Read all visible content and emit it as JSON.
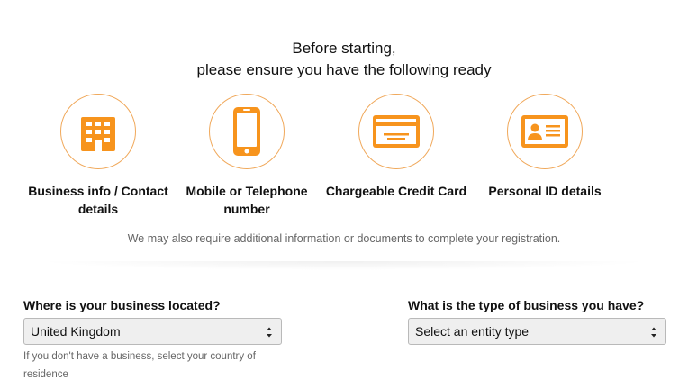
{
  "heading": {
    "line1": "Before starting,",
    "line2": "please ensure you have the following ready"
  },
  "requirements": [
    {
      "icon": "building-icon",
      "label": "Business info / Contact details"
    },
    {
      "icon": "mobile-phone-icon",
      "label": "Mobile or Telephone number"
    },
    {
      "icon": "credit-card-icon",
      "label": "Chargeable Credit Card"
    },
    {
      "icon": "id-card-icon",
      "label": "Personal ID details"
    }
  ],
  "note": "We may also require additional information or documents to complete your registration.",
  "location_field": {
    "label": "Where is your business located?",
    "value": "United Kingdom",
    "help": "If you don't have a business, select your country of residence"
  },
  "entity_field": {
    "label": "What is the type of business you have?",
    "value": "Select an entity type"
  },
  "colors": {
    "accent": "#f7941d",
    "circle_border": "#f0a85a",
    "muted_text": "#666666"
  }
}
